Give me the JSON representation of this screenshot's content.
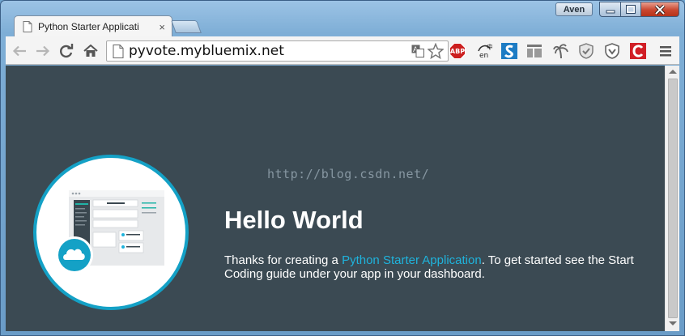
{
  "window": {
    "user_name": "Aven"
  },
  "tab": {
    "title": "Python Starter Applicati",
    "close_glyph": "×"
  },
  "toolbar": {
    "url": "pyvote.mybluemix.net",
    "extensions": [
      "translate-icon",
      "bookmark-star-icon",
      "adblock-plus-icon",
      "dictionary-en-icon",
      "s-extension-icon",
      "reader-layout-icon",
      "palm-tree-icon",
      "shield-icon",
      "vpn-shield-icon",
      "c-extension-icon",
      "menu-icon"
    ],
    "abp_label": "ABP",
    "en_label": "en"
  },
  "page": {
    "watermark": "http://blog.csdn.net/",
    "heading": "Hello World",
    "desc_before": "Thanks for creating a ",
    "desc_link": "Python Starter Application",
    "desc_after": ". To get started see the Start Coding guide under your app in your dashboard.",
    "colors": {
      "background": "#3b4a53",
      "accent": "#14a1c6",
      "link": "#1fb3dc"
    }
  }
}
